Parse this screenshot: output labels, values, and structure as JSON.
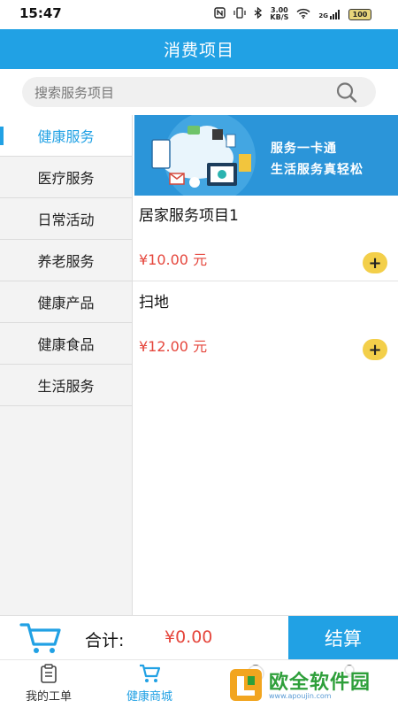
{
  "status": {
    "time": "15:47",
    "network_speed": "3.00",
    "speed_unit": "KB/S",
    "signal": "2G",
    "battery": "100"
  },
  "header": {
    "title": "消费项目"
  },
  "search": {
    "placeholder": "搜索服务项目"
  },
  "sidebar": {
    "items": [
      {
        "label": "健康服务",
        "active": true
      },
      {
        "label": "医疗服务"
      },
      {
        "label": "日常活动"
      },
      {
        "label": "养老服务"
      },
      {
        "label": "健康产品"
      },
      {
        "label": "健康食品"
      },
      {
        "label": "生活服务"
      }
    ]
  },
  "banner": {
    "line1": "服务一卡通",
    "line2": "生活服务真轻松"
  },
  "products": [
    {
      "name": "居家服务项目1",
      "price": "¥10.00 元"
    },
    {
      "name": "扫地",
      "price": "¥12.00 元"
    }
  ],
  "cart": {
    "total_label": "合计:",
    "total_amount": "¥0.00",
    "checkout_label": "结算"
  },
  "nav": {
    "items": [
      {
        "label": "我的工单"
      },
      {
        "label": "健康商城",
        "active": true
      },
      {
        "label": ""
      },
      {
        "label": ""
      }
    ]
  },
  "watermark": {
    "text": "欧全软件园",
    "url": "www.apoujin.com"
  },
  "colors": {
    "accent": "#21a1e4",
    "price": "#e5463c",
    "add_button": "#f3cf4a"
  }
}
